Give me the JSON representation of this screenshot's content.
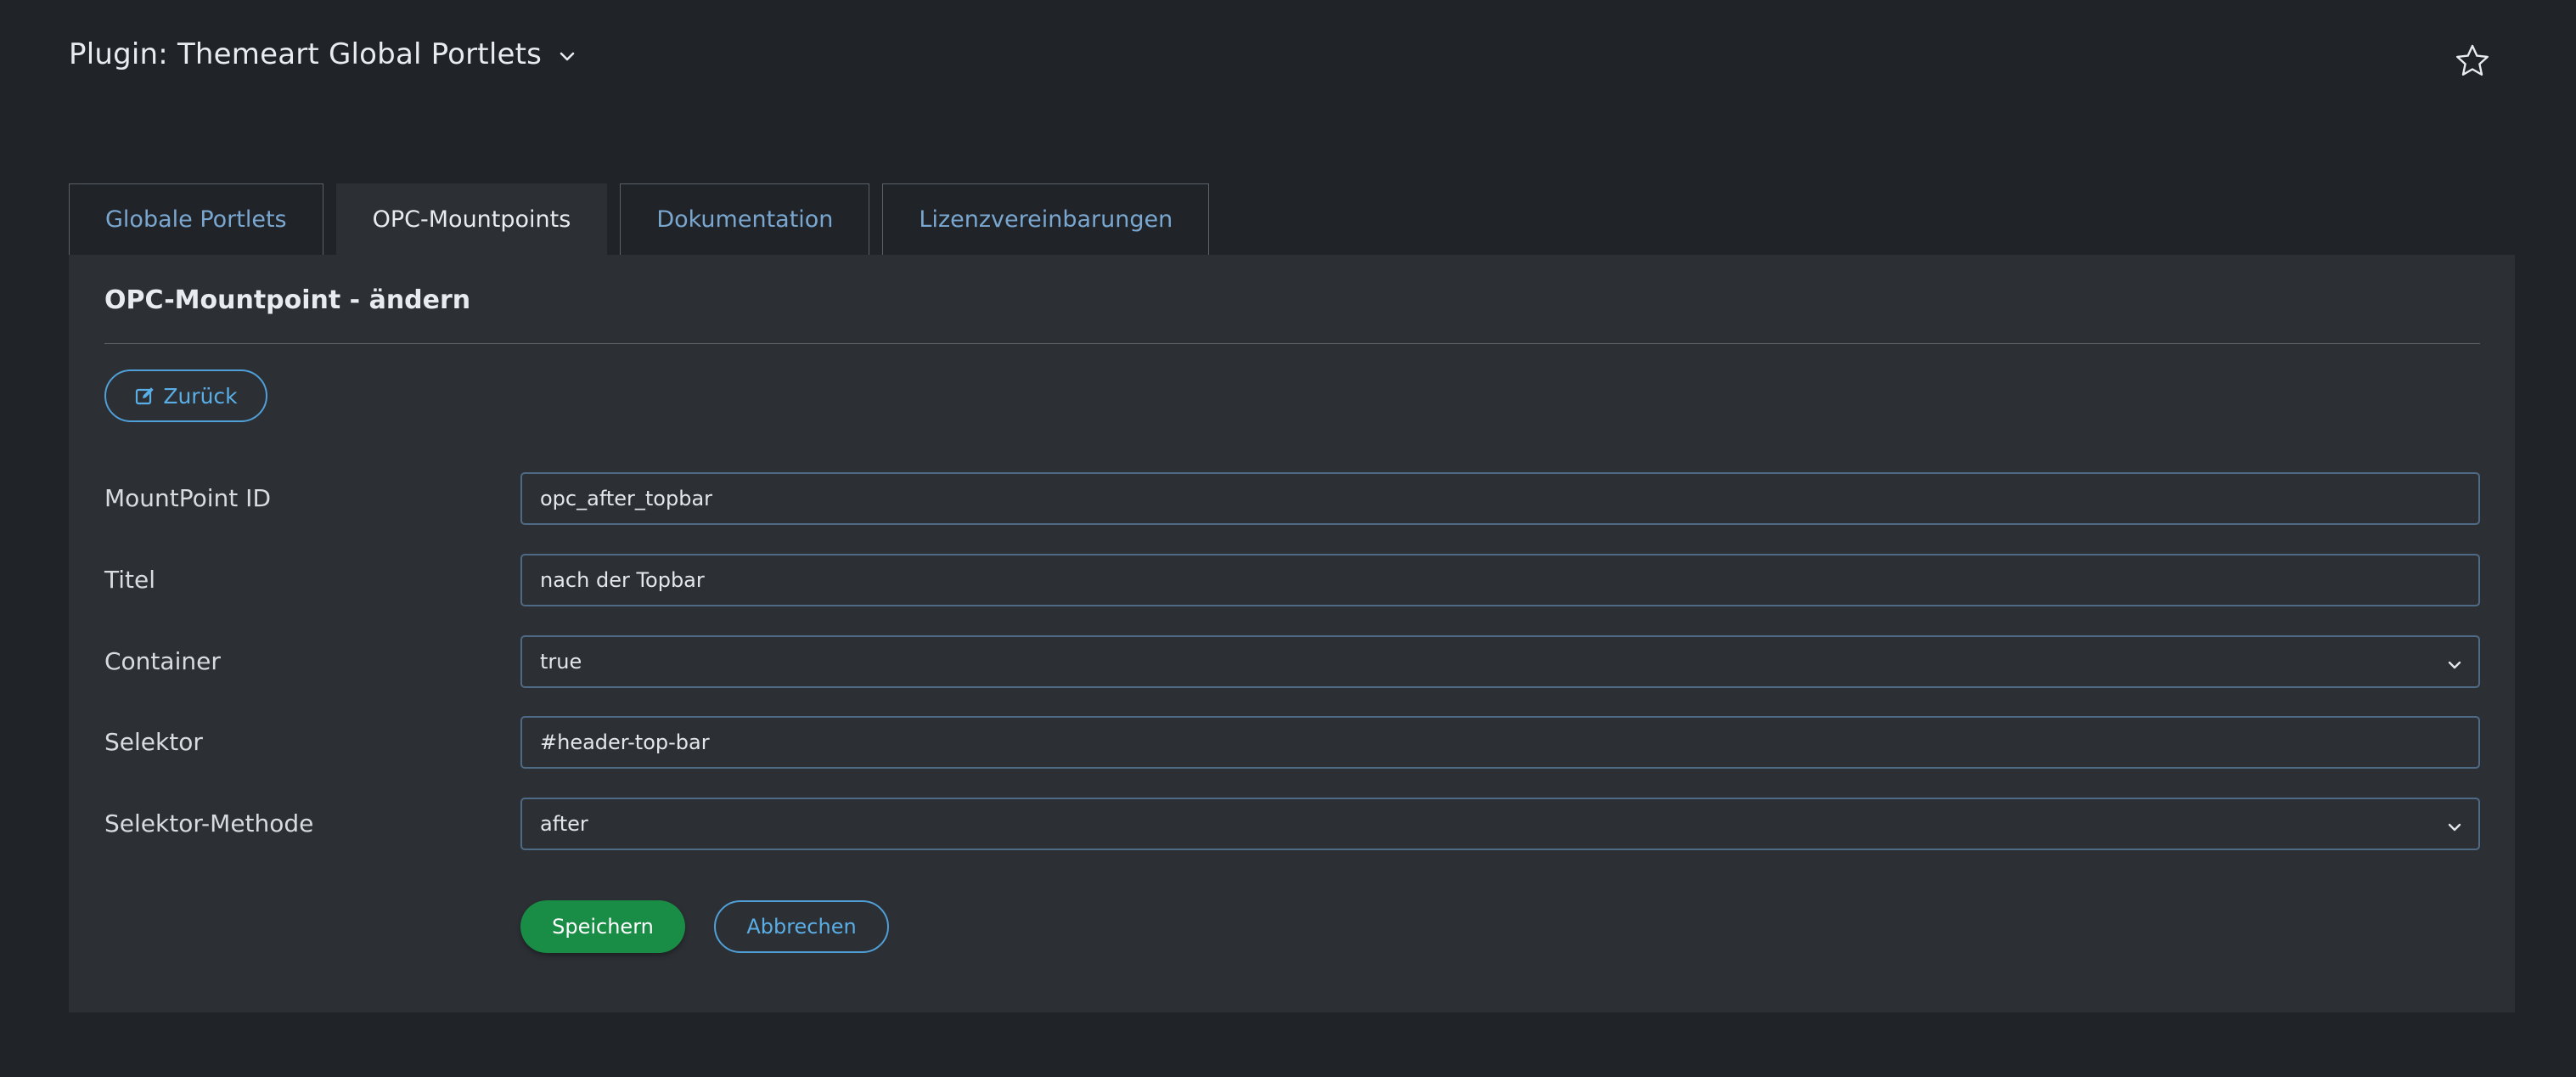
{
  "header": {
    "title": "Plugin: Themeart Global Portlets",
    "dropdown_icon": "chevron-down-icon",
    "favorite_icon": "star-icon"
  },
  "tabs": [
    {
      "label": "Globale Portlets",
      "active": false
    },
    {
      "label": "OPC-Mountpoints",
      "active": true
    },
    {
      "label": "Dokumentation",
      "active": false
    },
    {
      "label": "Lizenzvereinbarungen",
      "active": false
    }
  ],
  "panel": {
    "heading": "OPC-Mountpoint - ändern",
    "back_button": {
      "label": "Zurück",
      "icon": "edit-icon"
    }
  },
  "form": {
    "fields": [
      {
        "label": "MountPoint ID",
        "type": "text",
        "value": "opc_after_topbar"
      },
      {
        "label": "Titel",
        "type": "text",
        "value": "nach der Topbar"
      },
      {
        "label": "Container",
        "type": "select",
        "value": "true"
      },
      {
        "label": "Selektor",
        "type": "text",
        "value": "#header-top-bar"
      },
      {
        "label": "Selektor-Methode",
        "type": "select",
        "value": "after"
      }
    ],
    "save_label": "Speichern",
    "cancel_label": "Abbrechen"
  },
  "colors": {
    "background": "#202328",
    "panel": "#2c3035",
    "accent": "#4f9fd8",
    "link": "#7aa7d0",
    "success": "#198d45"
  }
}
